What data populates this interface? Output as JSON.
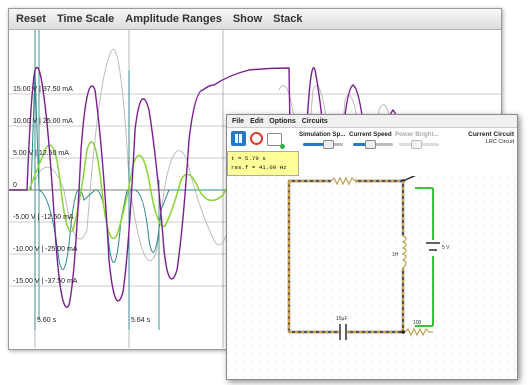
{
  "scope_menu": [
    "Reset",
    "Time Scale",
    "Amplitude Ranges",
    "Show",
    "Stack"
  ],
  "scale_labels": [
    "15.00 V | 37.50 mA",
    "10.00 V | 25.00 mA",
    "5.00 V | 12.50 mA",
    "0",
    "-5.00 V | -12.50 mA",
    "-10.00 V | -25.00 mA",
    "-15.00 V | -37.50 mA"
  ],
  "time_labels": [
    "5.60 s",
    "5.64 s"
  ],
  "circuit_menu": [
    "File",
    "Edit",
    "Options",
    "Circuits"
  ],
  "sliders": {
    "simulation_speed": "Simulation Sp...",
    "current_speed": "Current Speed",
    "power_brightness": "Power Bright..."
  },
  "current_circuit": {
    "title": "Current Circuit",
    "name": "LRC Circuit"
  },
  "info": {
    "time": "t = 5.79 s",
    "res_f": "res.f = 41.09 Hz"
  },
  "components": {
    "resistor_top": "10",
    "inductor": "1H",
    "battery": "5 V",
    "capacitor": "15µF",
    "resistor_bottom": "100"
  },
  "colors": {
    "voltage_trace": "#7a1f8f",
    "current_trace": "#8ed63f",
    "capacitor_trace": "#2f8a8a",
    "ghost_trace": "#bdbdbd",
    "wire_current": "#f2b640",
    "wire_active": "#39c23a"
  }
}
